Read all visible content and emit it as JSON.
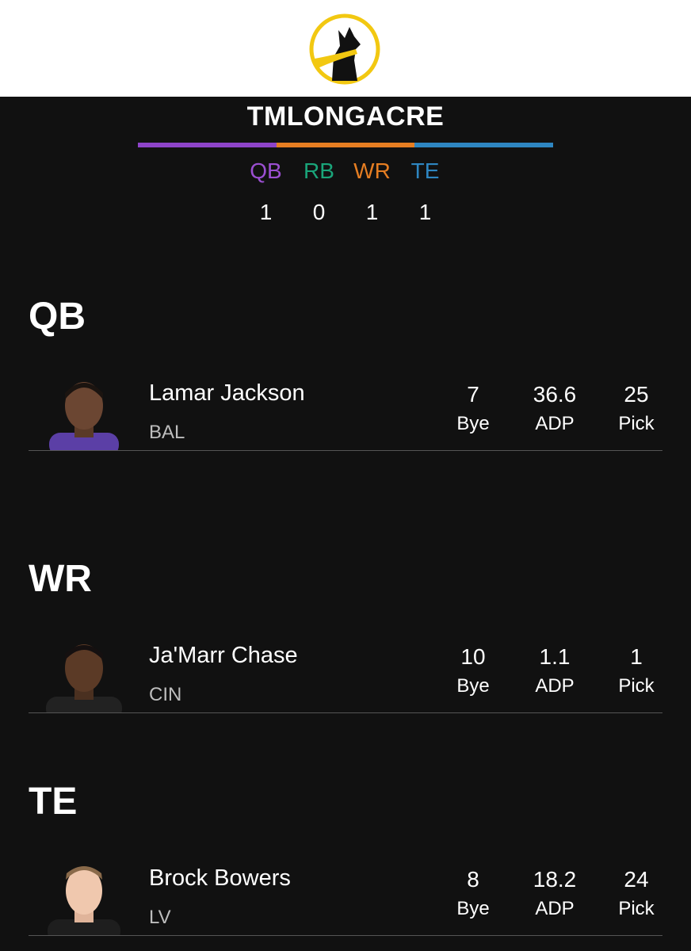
{
  "header": {
    "team_name": "TMLONGACRE",
    "bar_colors": [
      "#8e44c9",
      "#e67e22",
      "#2e86c1"
    ]
  },
  "position_counts": [
    {
      "label": "QB",
      "count": "1",
      "color": "#9b4fd1"
    },
    {
      "label": "RB",
      "count": "0",
      "color": "#1aa57a"
    },
    {
      "label": "WR",
      "count": "1",
      "color": "#e67e22"
    },
    {
      "label": "TE",
      "count": "1",
      "color": "#2e86c1"
    }
  ],
  "sections": [
    {
      "title": "QB",
      "player": {
        "name": "Lamar Jackson",
        "team": "BAL",
        "bye": "7",
        "bye_label": "Bye",
        "adp": "36.6",
        "adp_label": "ADP",
        "pick": "25",
        "pick_label": "Pick",
        "jersey_color": "#5b3fa6"
      }
    },
    {
      "title": "WR",
      "player": {
        "name": "Ja'Marr Chase",
        "team": "CIN",
        "bye": "10",
        "bye_label": "Bye",
        "adp": "1.1",
        "adp_label": "ADP",
        "pick": "1",
        "pick_label": "Pick",
        "jersey_color": "#222222"
      }
    },
    {
      "title": "TE",
      "player": {
        "name": "Brock Bowers",
        "team": "LV",
        "bye": "8",
        "bye_label": "Bye",
        "adp": "18.2",
        "adp_label": "ADP",
        "pick": "24",
        "pick_label": "Pick",
        "jersey_color": "#1e1e1e"
      }
    }
  ]
}
